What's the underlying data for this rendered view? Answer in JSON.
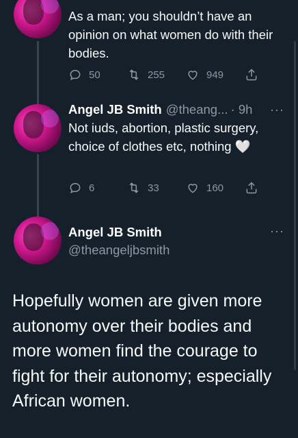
{
  "tweet1": {
    "body": "As a man; you shouldn’t have an opinion on what women do with their bodies.",
    "replies": "50",
    "retweets": "255",
    "likes": "949"
  },
  "tweet2": {
    "name": "Angel JB Smith",
    "handle": "@theang...",
    "time": "· 9h",
    "more": "···",
    "body": "Not iuds, abortion, plastic surgery, choice of clothes etc, nothing",
    "emoji": "🤍",
    "replies": "6",
    "retweets": "33",
    "likes": "160"
  },
  "main_tweet": {
    "name": "Angel JB Smith",
    "handle": "@theangeljbsmith",
    "more": "···",
    "body": "Hopefully women are given more autonomy over their bodies and more women find the courage to fight for their autonomy; especially African women."
  },
  "icons": {
    "reply": "reply-icon",
    "retweet": "retweet-icon",
    "like": "heart-icon",
    "share": "share-icon"
  },
  "colors": {
    "background": "#15202b",
    "muted": "#8b98a5",
    "text": "#f7f9f9"
  }
}
